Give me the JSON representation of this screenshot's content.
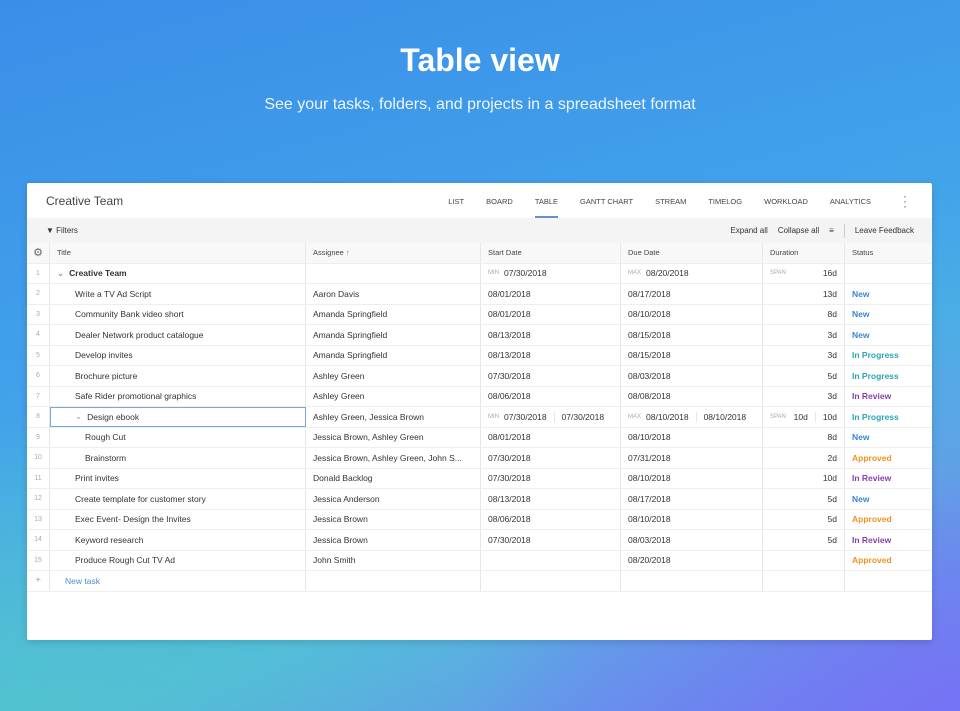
{
  "hero": {
    "title": "Table view",
    "subtitle": "See your tasks, folders, and projects in a spreadsheet format"
  },
  "project": {
    "title": "Creative Team"
  },
  "tabs": [
    {
      "label": "LIST"
    },
    {
      "label": "BOARD"
    },
    {
      "label": "TABLE",
      "active": true
    },
    {
      "label": "GANTT CHART"
    },
    {
      "label": "STREAM"
    },
    {
      "label": "TIMELOG"
    },
    {
      "label": "WORKLOAD"
    },
    {
      "label": "ANALYTICS"
    }
  ],
  "toolbar": {
    "filters": "Filters",
    "expand": "Expand all",
    "collapse": "Collapse all",
    "feedback": "Leave Feedback"
  },
  "columns": {
    "title": "Title",
    "assignee": "Assignee",
    "start": "Start Date",
    "due": "Due Date",
    "duration": "Duration",
    "status": "Status",
    "sort_arrow": "↑"
  },
  "labels": {
    "min": "MIN",
    "max": "MAX",
    "span": "SPAN"
  },
  "status_colors": {
    "New": "#3a86d1",
    "In Progress": "#2aa5b5",
    "In Review": "#8a3db0",
    "Approved": "#f0921e"
  },
  "rows": [
    {
      "n": "1",
      "title": "Creative Team",
      "assignee": "",
      "start": "07/30/2018",
      "due": "08/20/2018",
      "duration": "16d",
      "status": "",
      "level": 0,
      "folder": true
    },
    {
      "n": "2",
      "title": "Write a TV Ad Script",
      "assignee": "Aaron Davis",
      "start": "08/01/2018",
      "due": "08/17/2018",
      "duration": "13d",
      "status": "New",
      "level": 1
    },
    {
      "n": "3",
      "title": "Community Bank video short",
      "assignee": "Amanda Springfield",
      "start": "08/01/2018",
      "due": "08/10/2018",
      "duration": "8d",
      "status": "New",
      "level": 1
    },
    {
      "n": "4",
      "title": "Dealer Network product catalogue",
      "assignee": "Amanda Springfield",
      "start": "08/13/2018",
      "due": "08/15/2018",
      "duration": "3d",
      "status": "New",
      "level": 1
    },
    {
      "n": "5",
      "title": "Develop invites",
      "assignee": "Amanda Springfield",
      "start": "08/13/2018",
      "due": "08/15/2018",
      "duration": "3d",
      "status": "In Progress",
      "level": 1
    },
    {
      "n": "6",
      "title": "Brochure picture",
      "assignee": "Ashley Green",
      "start": "07/30/2018",
      "due": "08/03/2018",
      "duration": "5d",
      "status": "In Progress",
      "level": 1
    },
    {
      "n": "7",
      "title": "Safe Rider promotional graphics",
      "assignee": "Ashley Green",
      "start": "08/06/2018",
      "due": "08/08/2018",
      "duration": "3d",
      "status": "In Review",
      "level": 1
    },
    {
      "n": "8",
      "title": "Design ebook",
      "assignee": "Ashley Green, Jessica Brown",
      "start": "07/30/2018",
      "start2": "07/30/2018",
      "due": "08/10/2018",
      "due2": "08/10/2018",
      "duration": "10d",
      "duration2": "10d",
      "status": "In Progress",
      "level": 1,
      "parent": true
    },
    {
      "n": "9",
      "title": "Rough Cut",
      "assignee": "Jessica Brown, Ashley Green",
      "start": "08/01/2018",
      "due": "08/10/2018",
      "duration": "8d",
      "status": "New",
      "level": 2
    },
    {
      "n": "10",
      "title": "Brainstorm",
      "assignee": "Jessica Brown, Ashley Green, John S...",
      "start": "07/30/2018",
      "due": "07/31/2018",
      "duration": "2d",
      "status": "Approved",
      "level": 2
    },
    {
      "n": "11",
      "title": "Print invites",
      "assignee": "Donald Backlog",
      "start": "07/30/2018",
      "due": "08/10/2018",
      "duration": "10d",
      "status": "In Review",
      "level": 1
    },
    {
      "n": "12",
      "title": "Create template for customer story",
      "assignee": "Jessica Anderson",
      "start": "08/13/2018",
      "due": "08/17/2018",
      "duration": "5d",
      "status": "New",
      "level": 1
    },
    {
      "n": "13",
      "title": "Exec Event- Design the Invites",
      "assignee": "Jessica Brown",
      "start": "08/06/2018",
      "due": "08/10/2018",
      "duration": "5d",
      "status": "Approved",
      "level": 1
    },
    {
      "n": "14",
      "title": "Keyword research",
      "assignee": "Jessica Brown",
      "start": "07/30/2018",
      "due": "08/03/2018",
      "duration": "5d",
      "status": "In Review",
      "level": 1
    },
    {
      "n": "15",
      "title": "Produce Rough Cut TV Ad",
      "assignee": "John Smith",
      "start": "",
      "due": "08/20/2018",
      "duration": "",
      "status": "Approved",
      "level": 1
    }
  ],
  "new_task": {
    "plus": "+",
    "label": "New task"
  }
}
